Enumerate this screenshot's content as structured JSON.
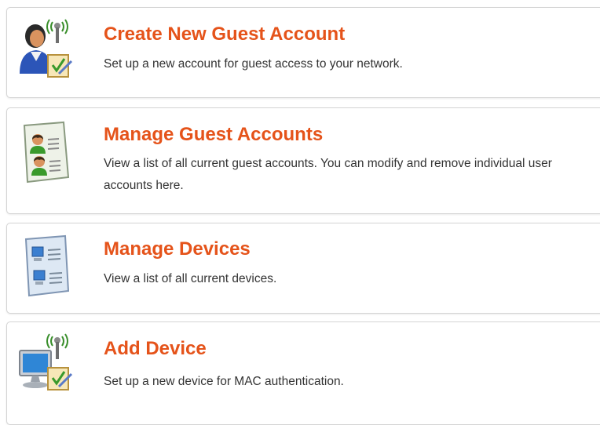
{
  "colors": {
    "title": "#e5531a",
    "text": "#333333",
    "border": "#d4d4d4"
  },
  "items": [
    {
      "icon": "guest-user-wireless-checklist-icon",
      "title": "Create New Guest Account",
      "description": "Set up a new account for guest access to your network."
    },
    {
      "icon": "guest-accounts-list-icon",
      "title": "Manage Guest Accounts",
      "description": "View a list of all current guest accounts. You can modify and remove individual user accounts here."
    },
    {
      "icon": "devices-list-icon",
      "title": "Manage Devices",
      "description": "View a list of all current devices."
    },
    {
      "icon": "computer-wireless-checklist-icon",
      "title": "Add Device",
      "description": "Set up a new device for MAC authentication."
    }
  ]
}
